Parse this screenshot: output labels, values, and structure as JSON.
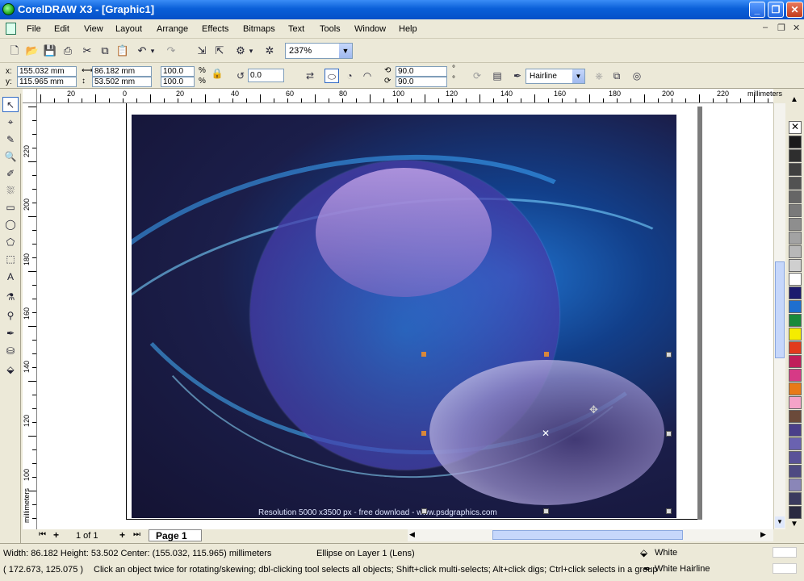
{
  "window": {
    "title": "CorelDRAW X3 - [Graphic1]"
  },
  "menu": [
    "File",
    "Edit",
    "View",
    "Layout",
    "Arrange",
    "Effects",
    "Bitmaps",
    "Text",
    "Tools",
    "Window",
    "Help"
  ],
  "standard_toolbar": {
    "zoom": "237%"
  },
  "property_bar": {
    "x": "155.032 mm",
    "y": "115.965 mm",
    "width": "86.182 mm",
    "height": "53.502 mm",
    "scale_x": "100.0",
    "scale_y": "100.0",
    "percent": "%",
    "rotation": "0.0",
    "start_angle": "90.0",
    "end_angle": "90.0",
    "outline": "Hairline",
    "x_label": "x:",
    "y_label": "y:"
  },
  "rulers": {
    "unit": "millimeters",
    "h_labels": [
      "20",
      "0",
      "20",
      "40",
      "60",
      "80",
      "100",
      "120",
      "140",
      "160",
      "180",
      "200",
      "220"
    ],
    "v_labels": [
      "220",
      "200",
      "180",
      "160",
      "140",
      "120",
      "100"
    ]
  },
  "canvas": {
    "caption": "Resolution 5000 x3500 px - free download - www.psdgraphics.com"
  },
  "page_nav": {
    "counter": "1 of 1",
    "tab": "Page 1"
  },
  "status": {
    "dims": "Width: 86.182  Height: 53.502  Center: (155.032, 115.965)  millimeters",
    "object": "Ellipse on Layer 1  (Lens)",
    "fill": "White",
    "outline": "White  Hairline",
    "cursor": "( 172.673, 125.075 )",
    "hint": "Click an object twice for rotating/skewing; dbl-clicking tool selects all objects; Shift+click multi-selects; Alt+click digs; Ctrl+click selects in a group"
  },
  "palette_colors": [
    "#1a1a1a",
    "#2e2e2e",
    "#404040",
    "#525252",
    "#666666",
    "#7a7a7a",
    "#8e8e8e",
    "#a3a3a3",
    "#b8b8b8",
    "#cfcfcf",
    "#ffffff",
    "#1c1a6e",
    "#1e6fd0",
    "#1a8a3a",
    "#f5ec00",
    "#e23a1c",
    "#c01e5a",
    "#d63a86",
    "#e87a18",
    "#f4a3c8",
    "#6b4a3a",
    "#4a3f8a",
    "#6a62b0",
    "#5a5298",
    "#4e4a82",
    "#8a86b8",
    "#3a3a5e",
    "#2a2a40"
  ]
}
